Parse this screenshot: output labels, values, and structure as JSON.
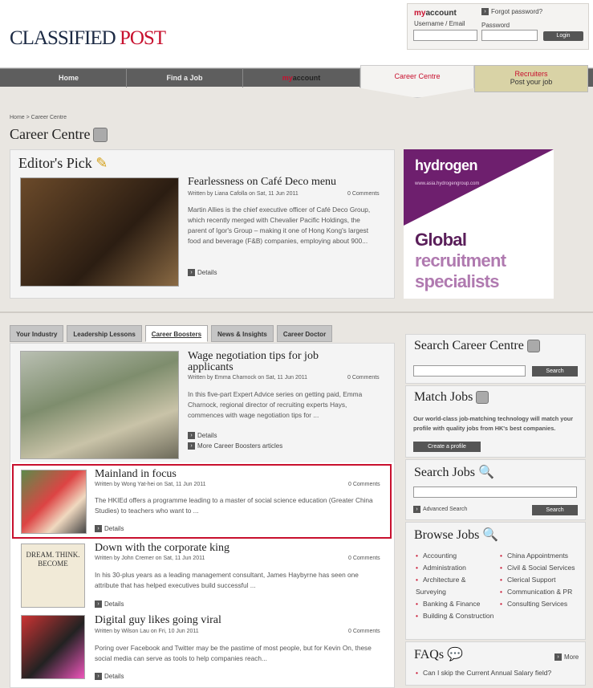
{
  "header": {
    "logo_part1": "CLASSIFIED",
    "logo_part2": "POST",
    "account_title_my": "my",
    "account_title": "account",
    "username_label": "Username / Email",
    "password_label": "Password",
    "forgot_password": "Forgot password?",
    "login_button": "Login"
  },
  "nav": {
    "home": "Home",
    "find_job": "Find a Job",
    "my": "my",
    "account": "account",
    "career_centre": "Career Centre",
    "recruiters": "Recruiters",
    "post_job": "Post your job"
  },
  "breadcrumb": "Home > Career Centre",
  "page_title": "Career Centre",
  "editors_pick": {
    "heading": "Editor's Pick",
    "title": "Fearlessness on Café Deco menu",
    "meta": "Written by Liana Cafolla on Sat, 11 Jun 2011",
    "comments": "0 Comments",
    "body": "Martin Allies is the chief executive officer of Café Deco Group, which recently merged with Chevalier Pacific Holdings, the parent of Igor's Group – making it one of Hong Kong's largest food and beverage (F&B) companies, employing about 900...",
    "details": "Details"
  },
  "ad": {
    "brand": "hydrogen",
    "url": "www.asia.hydrogengroup.com",
    "line1": "Global",
    "line2": "recruitment",
    "line3": "specialists"
  },
  "tabs": [
    "Your Industry",
    "Leadership Lessons",
    "Career Boosters",
    "News & Insights",
    "Career Doctor"
  ],
  "articles": [
    {
      "title": "Wage negotiation tips for job applicants",
      "meta": "Written by Emma Charnock on Sat, 11 Jun 2011",
      "comments": "0 Comments",
      "body": "In this five-part Expert Advice series on getting paid, Emma Charnock, regional director of recruiting experts Hays, commences with wage negotiation tips for ...",
      "details": "Details",
      "more": "More Career Boosters articles"
    },
    {
      "title": "Mainland in focus",
      "meta": "Written by Wong Yat-hei on Sat, 11 Jun 2011",
      "comments": "0 Comments",
      "body": "The HKIEd offers a programme leading to a master of social science education (Greater China Studies) to teachers who want to ...",
      "details": "Details"
    },
    {
      "title": "Down with the corporate king",
      "meta": "Written by John Cremer on Sat, 11 Jun 2011",
      "comments": "0 Comments",
      "body": "In his 30-plus years as a leading management consultant, James Haybyrne has seen one attribute that has helped executives build successful ...",
      "details": "Details",
      "book": "DREAM. THINK. BECOME"
    },
    {
      "title": "Digital guy likes going viral",
      "meta": "Written by Wilson Lau on Fri, 10 Jun 2011",
      "comments": "0 Comments",
      "body": "Poring over Facebook and Twitter may be the pastime of most people, but for Kevin On, these social media can serve as tools to help companies reach...",
      "details": "Details"
    }
  ],
  "sidebar": {
    "search_cc_title": "Search Career Centre",
    "search_button": "Search",
    "match_title": "Match Jobs",
    "match_body": "Our world-class job-matching technology will match your profile with quality jobs from HK's best companies.",
    "create_profile": "Create a profile",
    "search_jobs_title": "Search Jobs",
    "advanced_search": "Advanced Search",
    "browse_title": "Browse Jobs",
    "browse_left": [
      "Accounting",
      "Administration",
      "Architecture & Surveying",
      "Banking & Finance",
      "Building & Construction"
    ],
    "browse_right": [
      "China Appointments",
      "Civil & Social Services",
      "Clerical Support",
      "Communication & PR",
      "Consulting Services"
    ],
    "faqs_title": "FAQs",
    "faqs_more": "More",
    "faq1": "Can I skip the Current Annual Salary field?"
  }
}
